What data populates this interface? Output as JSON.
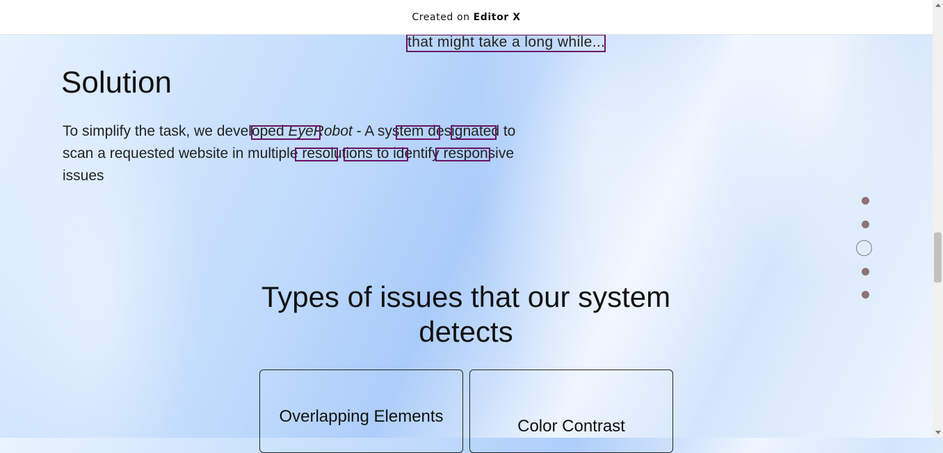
{
  "banner": {
    "prefix": "Created on",
    "brand": "Editor X"
  },
  "fragment": {
    "text": "that might take a long while",
    "ellipsis": "..."
  },
  "solution": {
    "title": "Solution",
    "body_pre": "To simplify the task, we developed ",
    "product": "EyeRobot",
    "body_post": " - A system designated to scan a requested website in multiple resolutions to identify responsive issues"
  },
  "section_nav": {
    "count": 5,
    "active_index": 2
  },
  "types": {
    "title": "Types of issues that our system detects",
    "cards": [
      {
        "label": "Overlapping Elements"
      },
      {
        "label": "Color Contrast"
      }
    ]
  },
  "colors": {
    "highlight": "#6b116b",
    "dot": "#8e7474"
  }
}
